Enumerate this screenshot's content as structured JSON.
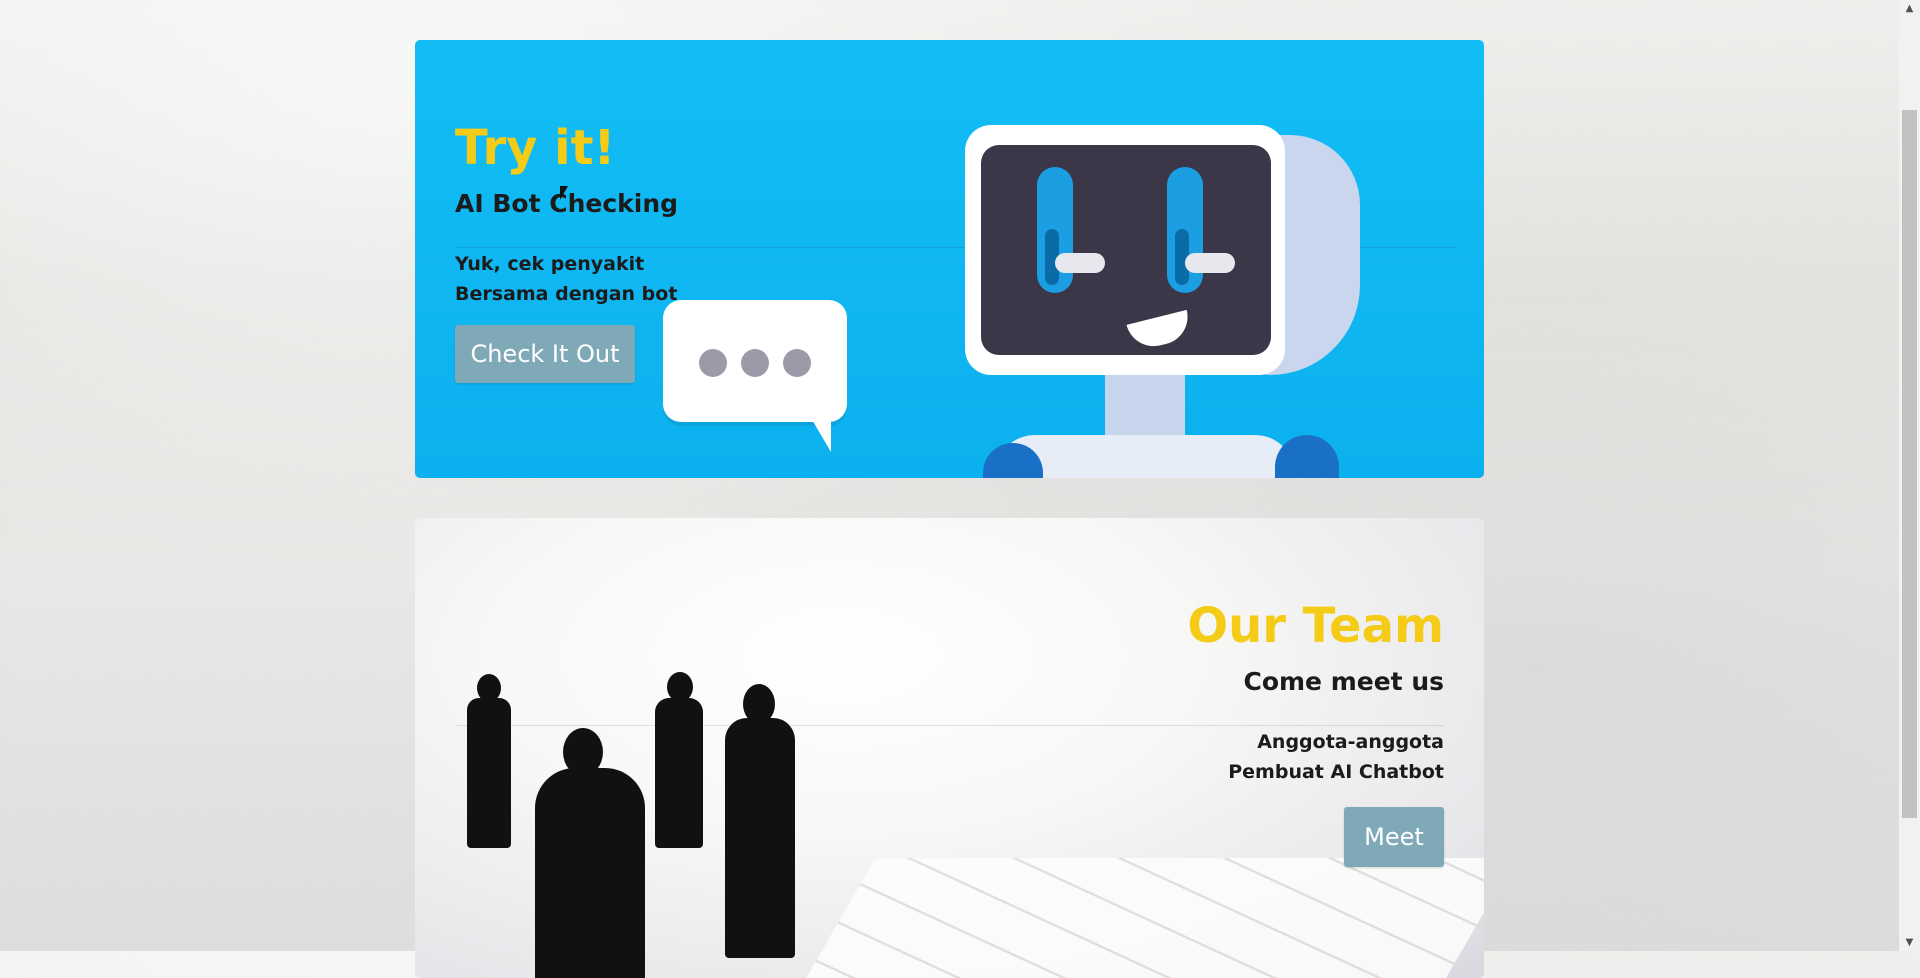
{
  "try_card": {
    "title": "Try it!",
    "subtitle": "AI Bot Checking",
    "desc_line1": "Yuk, cek penyakit",
    "desc_line2": "Bersama dengan bot",
    "button_label": "Check It Out",
    "bg_color": "#12bdf5",
    "title_color": "#f4cc18"
  },
  "team_card": {
    "title": "Our Team",
    "subtitle": "Come meet us",
    "desc_line1": "Anggota-anggota",
    "desc_line2": "Pembuat AI Chatbot",
    "button_label": "Meet"
  },
  "scrollbar": {
    "up_arrow": "▲",
    "down_arrow": "▼"
  }
}
